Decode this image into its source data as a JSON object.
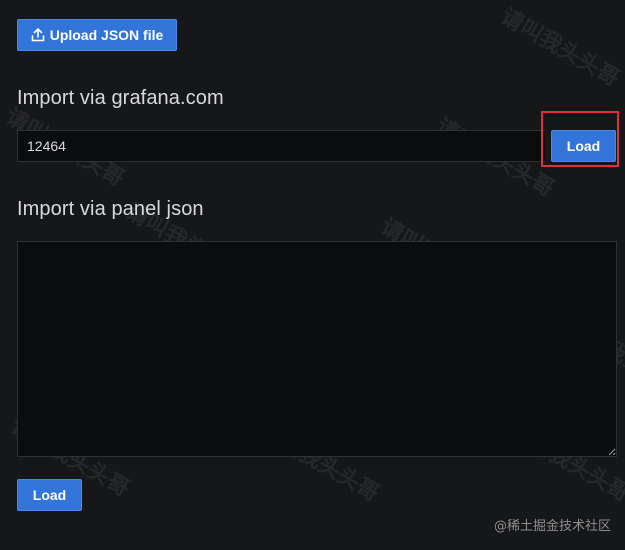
{
  "upload": {
    "label": "Upload JSON file",
    "icon": "upload-icon"
  },
  "grafana_import": {
    "title": "Import via grafana.com",
    "input_value": "12464",
    "load_label": "Load",
    "highlight_color": "#e02f44"
  },
  "panel_import": {
    "title": "Import via panel json",
    "textarea_value": "",
    "load_label": "Load"
  },
  "watermark_text": "请叫我头头哥",
  "credit_text": "@稀土掘金技术社区",
  "colors": {
    "background": "#161719",
    "input_background": "#0b0c0e",
    "primary_button": "#3274d9",
    "text": "#d8d9da"
  }
}
